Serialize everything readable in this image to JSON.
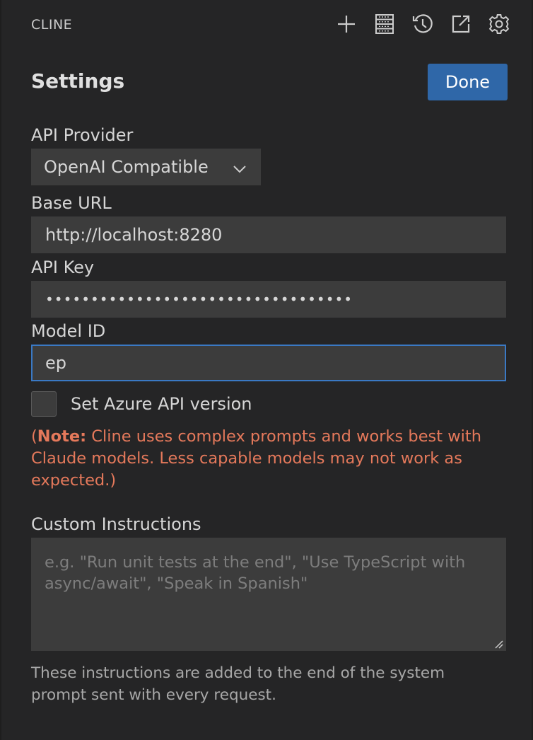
{
  "app": {
    "title": "CLINE"
  },
  "toolbar": {
    "icons": [
      "plus-icon",
      "server-icon",
      "history-icon",
      "popout-icon",
      "gear-icon"
    ]
  },
  "page": {
    "title": "Settings",
    "done_label": "Done"
  },
  "api_provider": {
    "label": "API Provider",
    "selected": "OpenAI Compatible"
  },
  "base_url": {
    "label": "Base URL",
    "value": "http://localhost:8280"
  },
  "api_key": {
    "label": "API Key",
    "masked_value": "••••••••••••••••••••••••••••••••••"
  },
  "model_id": {
    "label": "Model ID",
    "value": "ep"
  },
  "azure": {
    "label": "Set Azure API version",
    "checked": false
  },
  "note": {
    "prefix": "(",
    "strong": "Note:",
    "text": " Cline uses complex prompts and works best with Claude models. Less capable models may not work as expected.)"
  },
  "custom_instructions": {
    "label": "Custom Instructions",
    "placeholder": "e.g. \"Run unit tests at the end\", \"Use TypeScript with async/await\", \"Speak in Spanish\"",
    "value": "",
    "help": "These instructions are added to the end of the system prompt sent with every request."
  },
  "colors": {
    "background": "#252526",
    "input": "#3c3c3c",
    "accent": "#2f67a8",
    "focus_border": "#3a79c4",
    "note": "#e5795b"
  }
}
